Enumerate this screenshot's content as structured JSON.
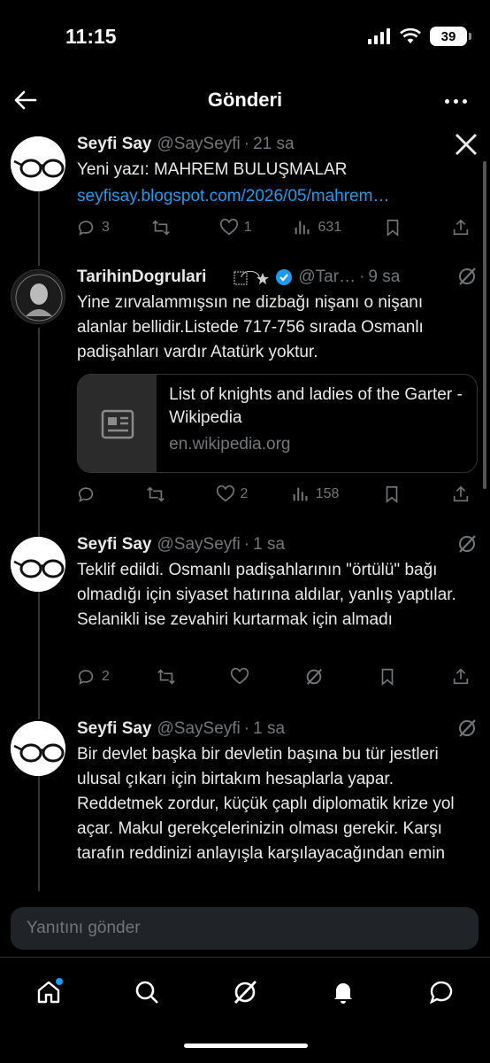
{
  "status": {
    "time": "11:15",
    "battery": "39"
  },
  "header": {
    "title": "Gönderi"
  },
  "tweets": [
    {
      "name": "Seyfi Say",
      "handle": "@SaySeyfi",
      "time": "21 sa",
      "text": "Yeni yazı: MAHREM BULUŞMALAR",
      "link": "seyfisay.blogspot.com/2026/05/mahrem…",
      "replies": "3",
      "retweets": "",
      "likes": "1",
      "views": "631"
    },
    {
      "name": "TarihinDogrulari",
      "handle": "@Tar…",
      "time": "9 sa",
      "text": "Yine zırvalammışsın ne dizbağı nişanı o nişanı alanlar bellidir.Listede 717-756 sırada Osmanlı padişahları vardır Atatürk yoktur.",
      "card_title": "List of knights and ladies of the Garter - Wikipedia",
      "card_domain": "en.wikipedia.org",
      "replies": "",
      "retweets": "",
      "likes": "2",
      "views": "158"
    },
    {
      "name": "Seyfi Say",
      "handle": "@SaySeyfi",
      "time": "1 sa",
      "text": "Teklif edildi. Osmanlı padişahlarının \"örtülü\" bağı olmadığı için siyaset hatırına aldılar, yanlış yaptılar. Selanikli ise zevahiri kurtarmak için almadı",
      "replies": "2",
      "retweets": "",
      "likes": "",
      "views": ""
    },
    {
      "name": "Seyfi Say",
      "handle": "@SaySeyfi",
      "time": "1 sa",
      "text": "Bir devlet başka bir devletin başına bu tür jestleri ulusal çıkarı için birtakım hesaplarla yapar. Reddetmek zordur, küçük çaplı diplomatik krize yol açar. Makul gerekçelerinizin olması gerekir. Karşı tarafın reddinizi anlayışla karşılayacağından emin olmalısınız."
    }
  ],
  "reply_bar": {
    "placeholder": "Yanıtını gönder"
  },
  "icons": [
    "back-arrow-icon",
    "more-icon",
    "x-logo-icon",
    "reply-icon",
    "retweet-icon",
    "like-icon",
    "views-icon",
    "bookmark-icon",
    "share-icon",
    "grok-icon",
    "verified-icon",
    "home-icon",
    "search-icon",
    "notifications-icon",
    "messages-icon"
  ],
  "colors": {
    "background": "#000000",
    "accent": "#1d9bf0",
    "muted": "#71767b",
    "text": "#e7e9ea"
  }
}
